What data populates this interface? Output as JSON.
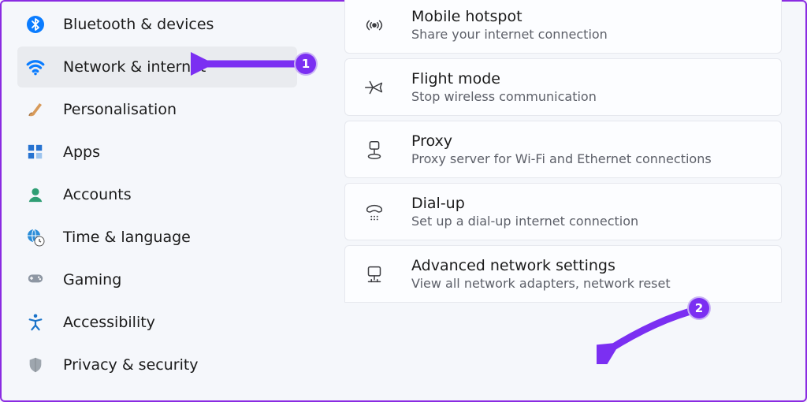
{
  "sidebar": {
    "items": [
      {
        "label": "Bluetooth & devices"
      },
      {
        "label": "Network & internet"
      },
      {
        "label": "Personalisation"
      },
      {
        "label": "Apps"
      },
      {
        "label": "Accounts"
      },
      {
        "label": "Time & language"
      },
      {
        "label": "Gaming"
      },
      {
        "label": "Accessibility"
      },
      {
        "label": "Privacy & security"
      }
    ],
    "selected_index": 1
  },
  "content": {
    "cards": [
      {
        "title": "Mobile hotspot",
        "subtitle": "Share your internet connection"
      },
      {
        "title": "Flight mode",
        "subtitle": "Stop wireless communication"
      },
      {
        "title": "Proxy",
        "subtitle": "Proxy server for Wi-Fi and Ethernet connections"
      },
      {
        "title": "Dial-up",
        "subtitle": "Set up a dial-up internet connection"
      },
      {
        "title": "Advanced network settings",
        "subtitle": "View all network adapters, network reset"
      }
    ]
  },
  "annotations": {
    "step1": "1",
    "step2": "2"
  },
  "colors": {
    "accent": "#7b2ff2"
  }
}
